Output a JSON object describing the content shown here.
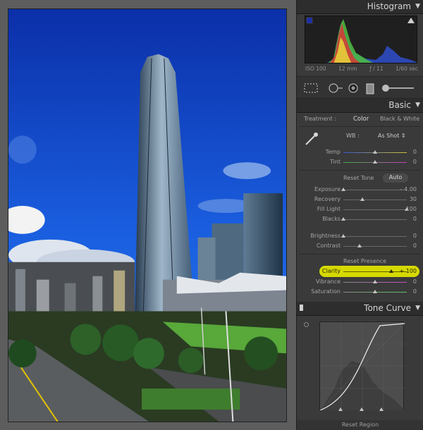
{
  "histogram": {
    "title": "Histogram",
    "iso": "ISO 100",
    "focal": "12 mm",
    "aperture": "ƒ / 11",
    "shutter": "1/60 sec"
  },
  "basic": {
    "title": "Basic",
    "treatment_label": "Treatment :",
    "treatment_color": "Color",
    "treatment_bw": "Black & White",
    "wb_label": "WB :",
    "wb_value": "As Shot",
    "reset_tone": "Reset Tone",
    "auto": "Auto",
    "reset_presence": "Reset Presence",
    "sliders": {
      "temp": {
        "label": "Temp",
        "value": "0",
        "level": 0.5
      },
      "tint": {
        "label": "Tint",
        "value": "0",
        "level": 0.5
      },
      "exposure": {
        "label": "Exposure",
        "value": "- 4.00",
        "level": 0.0
      },
      "recovery": {
        "label": "Recovery",
        "value": "30",
        "level": 0.3
      },
      "fill": {
        "label": "Fill Light",
        "value": "100",
        "level": 1.0
      },
      "blacks": {
        "label": "Blacks",
        "value": "0",
        "level": 0.0
      },
      "brightness": {
        "label": "Brightness",
        "value": "0",
        "level": 0.0
      },
      "contrast": {
        "label": "Contrast",
        "value": "0",
        "level": 0.25
      },
      "clarity": {
        "label": "Clarity",
        "value": "+ 100",
        "level": 1.0
      },
      "vibrance": {
        "label": "Vibrance",
        "value": "0",
        "level": 0.5
      },
      "saturation": {
        "label": "Saturation",
        "value": "0",
        "level": 0.5
      }
    }
  },
  "tone_curve": {
    "title": "Tone Curve"
  },
  "reset_region": "Reset Region",
  "colors": {
    "highlight": "#d6d900",
    "panel_bg": "#3a3a3a"
  }
}
